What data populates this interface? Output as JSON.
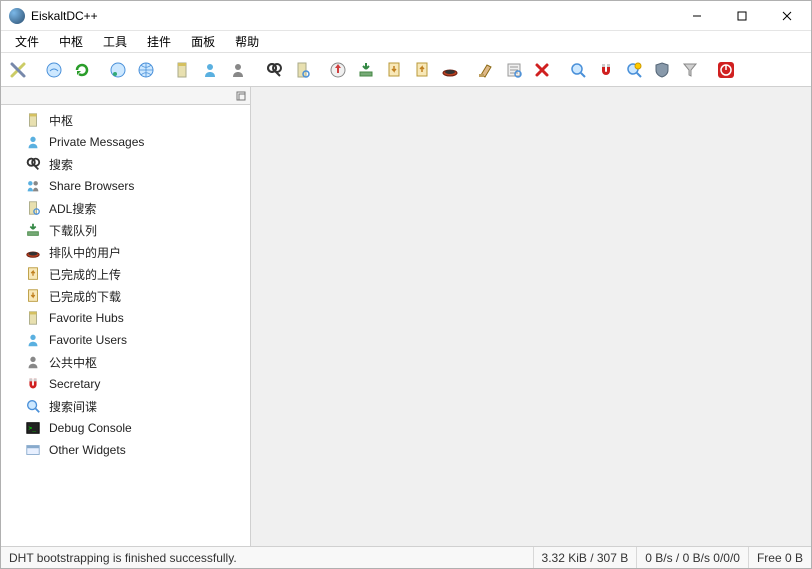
{
  "window": {
    "title": "EiskaltDC++"
  },
  "menu": {
    "items": [
      "文件",
      "中枢",
      "工具",
      "挂件",
      "面板",
      "帮助"
    ]
  },
  "toolbar": {
    "buttons": [
      {
        "name": "settings-icon"
      },
      {
        "sep": true
      },
      {
        "name": "connect-icon"
      },
      {
        "name": "reconnect-icon"
      },
      {
        "sep": true
      },
      {
        "name": "quick-connect-icon"
      },
      {
        "name": "internet-hubs-icon"
      },
      {
        "sep": true
      },
      {
        "name": "favorite-hubs-icon"
      },
      {
        "name": "favorite-users-icon"
      },
      {
        "name": "public-hubs-icon"
      },
      {
        "sep": true
      },
      {
        "name": "search-icon"
      },
      {
        "name": "adl-search-icon"
      },
      {
        "sep": true
      },
      {
        "name": "hash-progress-icon"
      },
      {
        "name": "download-queue-icon"
      },
      {
        "name": "finished-downloads-icon"
      },
      {
        "name": "finished-uploads-icon"
      },
      {
        "name": "upload-queue-icon"
      },
      {
        "sep": true
      },
      {
        "name": "clear-icon"
      },
      {
        "name": "refresh-list-icon"
      },
      {
        "name": "remove-icon"
      },
      {
        "sep": true
      },
      {
        "name": "search-spy-icon"
      },
      {
        "name": "magnet-icon"
      },
      {
        "name": "secretary-icon"
      },
      {
        "name": "shield-icon"
      },
      {
        "name": "filter-icon"
      },
      {
        "sep": true
      },
      {
        "name": "power-icon"
      }
    ]
  },
  "sidebar": {
    "items": [
      {
        "icon": "hub-icon",
        "label": "中枢"
      },
      {
        "icon": "pm-icon",
        "label": "Private Messages"
      },
      {
        "icon": "search-icon",
        "label": "搜索"
      },
      {
        "icon": "share-browser-icon",
        "label": "Share Browsers"
      },
      {
        "icon": "adl-search-icon",
        "label": "ADL搜索"
      },
      {
        "icon": "download-queue-icon",
        "label": "下载队列"
      },
      {
        "icon": "upload-queue-icon",
        "label": "排队中的用户"
      },
      {
        "icon": "finished-uploads-icon",
        "label": "已完成的上传"
      },
      {
        "icon": "finished-downloads-icon",
        "label": "已完成的下载"
      },
      {
        "icon": "favorite-hubs-icon",
        "label": "Favorite Hubs"
      },
      {
        "icon": "favorite-users-icon",
        "label": "Favorite Users"
      },
      {
        "icon": "public-hubs-icon",
        "label": "公共中枢"
      },
      {
        "icon": "magnet-icon",
        "label": "Secretary"
      },
      {
        "icon": "search-spy-icon",
        "label": "搜索间谍"
      },
      {
        "icon": "console-icon",
        "label": "Debug Console"
      },
      {
        "icon": "other-widgets-icon",
        "label": "Other Widgets"
      }
    ]
  },
  "status": {
    "message": "DHT bootstrapping is finished successfully.",
    "traffic": "3.32 KiB / 307 B",
    "speed": "0 B/s / 0 B/s 0/0/0",
    "free": "Free 0 B"
  }
}
